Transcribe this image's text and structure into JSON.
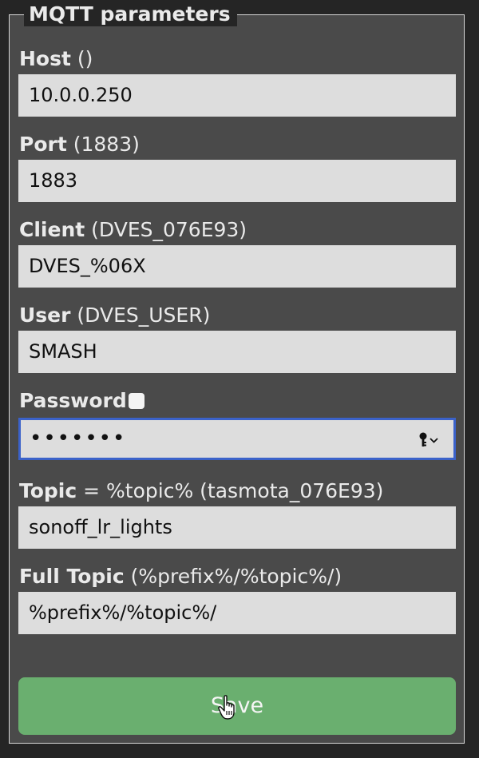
{
  "section": {
    "legend": "MQTT parameters"
  },
  "fields": [
    {
      "label": "Host",
      "hint": " ()",
      "value": "10.0.0.250"
    },
    {
      "label": "Port",
      "hint": " (1883)",
      "value": "1883"
    },
    {
      "label": "Client",
      "hint": " (DVES_076E93)",
      "value": "DVES_%06X"
    },
    {
      "label": "User",
      "hint": " (DVES_USER)",
      "value": "SMASH"
    }
  ],
  "password": {
    "label": "Password",
    "masked_value": "•••••••"
  },
  "topic": {
    "label": "Topic",
    "hint": " = %topic% (tasmota_076E93)",
    "value": "sonoff_lr_lights"
  },
  "full_topic": {
    "label": "Full Topic",
    "hint": " (%prefix%/%topic%/)",
    "value": "%prefix%/%topic%/"
  },
  "save_label": "Save",
  "colors": {
    "accent_focus": "#3b62c9",
    "button": "#6aaf6f",
    "panel": "#4a4a4a"
  }
}
